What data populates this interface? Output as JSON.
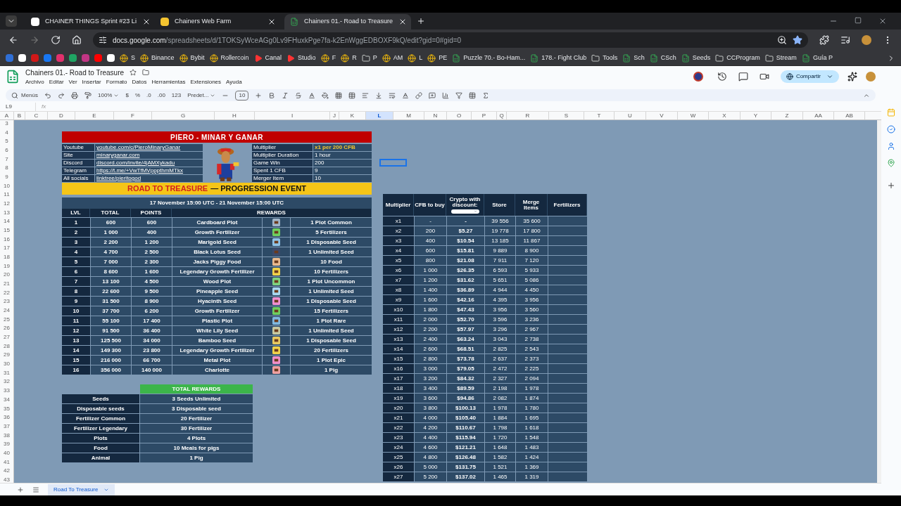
{
  "browser": {
    "tabs": [
      {
        "title": "CHAINER THINGS Sprint #23 Li",
        "selected": false,
        "kind": "letter"
      },
      {
        "title": "Chainers Web Farm",
        "selected": false,
        "kind": "face"
      },
      {
        "title": "Chainers 01.- Road to Treasure",
        "selected": true,
        "kind": "sheet"
      }
    ],
    "url_host": "docs.google.com",
    "url_path": "/spreadsheets/d/1TOKSyWceAGg0Lv9FHuxkPge7fa-k2EnWggEDBOXF9kQ/edit?gid=0#gid=0",
    "bookmarks": [
      {
        "label": "S",
        "kind": "site"
      },
      {
        "label": "Binance",
        "kind": "site"
      },
      {
        "label": "Bybit",
        "kind": "site"
      },
      {
        "label": "Rollercoin",
        "kind": "site"
      },
      {
        "label": "Canal",
        "kind": "video"
      },
      {
        "label": "Studio",
        "kind": "video"
      },
      {
        "label": "F",
        "kind": "site"
      },
      {
        "label": "R",
        "kind": "site"
      },
      {
        "label": "P",
        "kind": "folder"
      },
      {
        "label": "AM",
        "kind": "site"
      },
      {
        "label": "L",
        "kind": "site"
      },
      {
        "label": "PE",
        "kind": "site"
      },
      {
        "label": "Puzzle 70.- Bo-Ham...",
        "kind": "sheet"
      },
      {
        "label": "178.- Fight Club",
        "kind": "sheet"
      },
      {
        "label": "Tools",
        "kind": "folder"
      },
      {
        "label": "Sch",
        "kind": "sheet"
      },
      {
        "label": "CSch",
        "kind": "sheet"
      },
      {
        "label": "Seeds",
        "kind": "sheet"
      },
      {
        "label": "CCProgram",
        "kind": "folder"
      },
      {
        "label": "Stream",
        "kind": "folder"
      },
      {
        "label": "Guía P",
        "kind": "sheet"
      }
    ]
  },
  "doc": {
    "title": "Chainers 01.- Road to Treasure",
    "menus": [
      "Archivo",
      "Editar",
      "Ver",
      "Insertar",
      "Formato",
      "Datos",
      "Herramientas",
      "Extensiones",
      "Ayuda"
    ],
    "share": "Compartir"
  },
  "toolbar": {
    "menus": "Menús",
    "zoom": "100%",
    "currency": "$",
    "percent": "%",
    "dec_less": ".0",
    "dec_more": ".00",
    "format": "123",
    "font": "Predet...",
    "size": "10"
  },
  "formula_bar": {
    "cell": "L9",
    "fx": "fx"
  },
  "columns": [
    {
      "label": "A",
      "selected": false
    },
    {
      "label": "B",
      "selected": false
    },
    {
      "label": "C",
      "selected": false
    },
    {
      "label": "D",
      "selected": false
    },
    {
      "label": "E",
      "selected": false
    },
    {
      "label": "F",
      "selected": false
    },
    {
      "label": "G",
      "selected": false
    },
    {
      "label": "H",
      "selected": false
    },
    {
      "label": "I",
      "selected": false
    },
    {
      "label": "J",
      "selected": false
    },
    {
      "label": "K",
      "selected": false
    },
    {
      "label": "L",
      "selected": true
    },
    {
      "label": "M",
      "selected": false
    },
    {
      "label": "N",
      "selected": false
    },
    {
      "label": "O",
      "selected": false
    },
    {
      "label": "P",
      "selected": false
    },
    {
      "label": "Q",
      "selected": false
    },
    {
      "label": "R",
      "selected": false
    },
    {
      "label": "S",
      "selected": false
    },
    {
      "label": "T",
      "selected": false
    },
    {
      "label": "U",
      "selected": false
    },
    {
      "label": "V",
      "selected": false
    },
    {
      "label": "W",
      "selected": false
    },
    {
      "label": "X",
      "selected": false
    },
    {
      "label": "Y",
      "selected": false
    },
    {
      "label": "Z",
      "selected": false
    },
    {
      "label": "AA",
      "selected": false
    },
    {
      "label": "AB",
      "selected": false
    }
  ],
  "rows": [
    "3",
    "4",
    "5",
    "6",
    "7",
    "8",
    "9",
    "10",
    "11",
    "12",
    "13",
    "14",
    "15",
    "16",
    "17",
    "18",
    "19",
    "20",
    "21",
    "22",
    "23",
    "24",
    "25",
    "26",
    "27",
    "28",
    "29",
    "30",
    "31",
    "32",
    "33",
    "34",
    "35",
    "36",
    "37",
    "38",
    "39",
    "40",
    "41",
    "42",
    "43"
  ],
  "profile": {
    "title": "PIERO - MINAR Y GANAR",
    "links": [
      {
        "label": "Youtube",
        "value": "youtube.com/c/PieroMinaryGanar"
      },
      {
        "label": "Site",
        "value": "minaryganar.com"
      },
      {
        "label": "Discord",
        "value": "discord.com/invite/4jAMXykadu"
      },
      {
        "label": "Telegram",
        "value": "https://t.me/+VwTfMVpppthmMTkx"
      },
      {
        "label": "All socials",
        "value": "linktree/pieritogod"
      }
    ],
    "stats": [
      {
        "label": "Multiplier",
        "value": "x1 per 200 CFB",
        "highlight": true
      },
      {
        "label": "Multiplier Duration",
        "value": "1 hour",
        "highlight": false
      },
      {
        "label": "Game Win",
        "value": "200",
        "highlight": false
      },
      {
        "label": "Spent 1 CFB",
        "value": "9",
        "highlight": false
      },
      {
        "label": "Merger Item",
        "value": "10",
        "highlight": false
      }
    ]
  },
  "progression": {
    "banner_highlight": "ROAD TO TREASURE",
    "banner_rest": "— PROGRESSION EVENT",
    "dates": "17 November 15:00 UTC - 21 November 15:00 UTC",
    "headers": [
      "LVL",
      "TOTAL",
      "POINTS",
      "REWARDS"
    ],
    "levels": [
      [
        "1",
        "600",
        "600",
        "Cardboard Plot",
        "1 Plot Common"
      ],
      [
        "2",
        "1 000",
        "400",
        "Growth Fertilizer",
        "5 Fertilizers"
      ],
      [
        "3",
        "2 200",
        "1 200",
        "Marigold Seed",
        "1 Disposable Seed"
      ],
      [
        "4",
        "4 700",
        "2 500",
        "Black Lotus Seed",
        "1 Unlimited Seed"
      ],
      [
        "5",
        "7 000",
        "2 300",
        "Jacks Piggy Food",
        "10 Food"
      ],
      [
        "6",
        "8 600",
        "1 600",
        "Legendary Growth Fertilizer",
        "10 Fertilizers"
      ],
      [
        "7",
        "13 100",
        "4 500",
        "Wood Plot",
        "1 Plot Uncommon"
      ],
      [
        "8",
        "22 600",
        "9 500",
        "Pineapple Seed",
        "1 Unlimited Seed"
      ],
      [
        "9",
        "31 500",
        "8 900",
        "Hyacinth Seed",
        "1 Disposable Seed"
      ],
      [
        "10",
        "37 700",
        "6 200",
        "Growth Fertilizer",
        "15 Fertilizers"
      ],
      [
        "11",
        "55 100",
        "17 400",
        "Plastic Plot",
        "1 Plot Rare"
      ],
      [
        "12",
        "91 500",
        "36 400",
        "White Lily Seed",
        "1 Unlimited Seed"
      ],
      [
        "13",
        "125 500",
        "34 000",
        "Bamboo Seed",
        "1 Disposable Seed"
      ],
      [
        "14",
        "149 300",
        "23 800",
        "Legendary Growth Fertilizer",
        "20 Fertilizers"
      ],
      [
        "15",
        "216 000",
        "66 700",
        "Metal Plot",
        "1 Plot Epic"
      ],
      [
        "16",
        "356 000",
        "140 000",
        "Charlotte",
        "1 Pig"
      ]
    ]
  },
  "totals": {
    "title": "TOTAL REWARDS",
    "rows": [
      [
        "Seeds",
        "3 Seeds Unlimited"
      ],
      [
        "Disposable seeds",
        "3 Disposable seed"
      ],
      [
        "Fertilizer Common",
        "20 Fertilizer"
      ],
      [
        "Fertilizer Legendary",
        "30 Fertilizer"
      ],
      [
        "Plots",
        "4 Plots"
      ],
      [
        "Food",
        "10 Meals for pigs"
      ],
      [
        "Animal",
        "1 Pig"
      ]
    ]
  },
  "multipliers": {
    "headers": [
      "Multiplier",
      "CFB to buy",
      "Crypto with discount:",
      "Store",
      "Merge Items",
      "Fertilizers"
    ],
    "rows": [
      [
        "x1",
        "-",
        "-",
        "39 556",
        "35 600"
      ],
      [
        "x2",
        "200",
        "$5.27",
        "19 778",
        "17 800"
      ],
      [
        "x3",
        "400",
        "$10.54",
        "13 185",
        "11 867"
      ],
      [
        "x4",
        "600",
        "$15.81",
        "9 889",
        "8 900"
      ],
      [
        "x5",
        "800",
        "$21.08",
        "7 911",
        "7 120"
      ],
      [
        "x6",
        "1 000",
        "$26.35",
        "6 593",
        "5 933"
      ],
      [
        "x7",
        "1 200",
        "$31.62",
        "5 651",
        "5 086"
      ],
      [
        "x8",
        "1 400",
        "$36.89",
        "4 944",
        "4 450"
      ],
      [
        "x9",
        "1 600",
        "$42.16",
        "4 395",
        "3 956"
      ],
      [
        "x10",
        "1 800",
        "$47.43",
        "3 956",
        "3 560"
      ],
      [
        "x11",
        "2 000",
        "$52.70",
        "3 596",
        "3 236"
      ],
      [
        "x12",
        "2 200",
        "$57.97",
        "3 296",
        "2 967"
      ],
      [
        "x13",
        "2 400",
        "$63.24",
        "3 043",
        "2 738"
      ],
      [
        "x14",
        "2 600",
        "$68.51",
        "2 825",
        "2 543"
      ],
      [
        "x15",
        "2 800",
        "$73.78",
        "2 637",
        "2 373"
      ],
      [
        "x16",
        "3 000",
        "$79.05",
        "2 472",
        "2 225"
      ],
      [
        "x17",
        "3 200",
        "$84.32",
        "2 327",
        "2 094"
      ],
      [
        "x18",
        "3 400",
        "$89.59",
        "2 198",
        "1 978"
      ],
      [
        "x19",
        "3 600",
        "$94.86",
        "2 082",
        "1 874"
      ],
      [
        "x20",
        "3 800",
        "$100.13",
        "1 978",
        "1 780"
      ],
      [
        "x21",
        "4 000",
        "$105.40",
        "1 884",
        "1 695"
      ],
      [
        "x22",
        "4 200",
        "$110.67",
        "1 798",
        "1 618"
      ],
      [
        "x23",
        "4 400",
        "$115.94",
        "1 720",
        "1 548"
      ],
      [
        "x24",
        "4 600",
        "$121.21",
        "1 648",
        "1 483"
      ],
      [
        "x25",
        "4 800",
        "$126.48",
        "1 582",
        "1 424"
      ],
      [
        "x26",
        "5 000",
        "$131.75",
        "1 521",
        "1 369"
      ],
      [
        "x27",
        "5 200",
        "$137.02",
        "1 465",
        "1 319"
      ]
    ]
  },
  "sheet_tabs": [
    {
      "label": "Road To Treasure",
      "selected": true
    }
  ]
}
